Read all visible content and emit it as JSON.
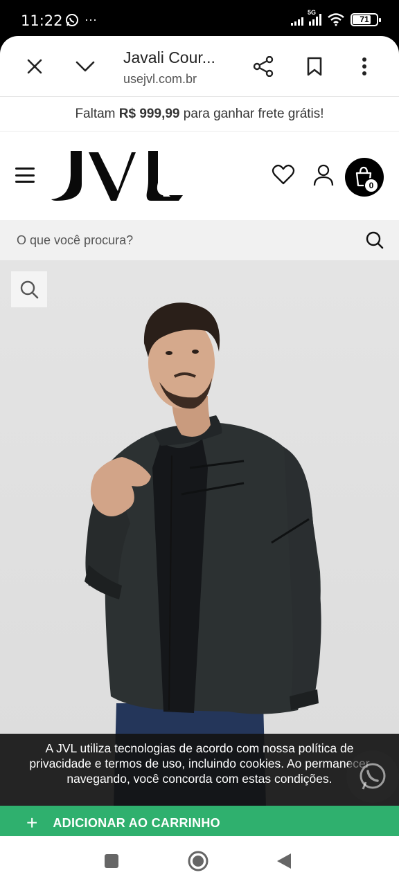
{
  "status_bar": {
    "time": "11:22",
    "more": "···",
    "network": "5G",
    "battery": "71",
    "battery_level": 0.71
  },
  "browser": {
    "title": "Javali Cour...",
    "url": "usejvl.com.br"
  },
  "shipping_banner": {
    "prefix": "Faltam ",
    "amount": "R$ 999,99",
    "suffix": " para ganhar frete grátis!"
  },
  "header": {
    "logo": "JVL",
    "cart_count": "0"
  },
  "search": {
    "placeholder": "O que você procura?"
  },
  "cookie": {
    "text": "A JVL utiliza tecnologias de acordo com nossa política de privacidade e termos de uso, incluindo cookies. Ao permanecer navegando, você concorda com estas condições."
  },
  "add_to_cart": {
    "plus": "+",
    "label": "ADICIONAR AO CARRINHO"
  },
  "colors": {
    "accent_green": "#2fb06e",
    "black": "#000000"
  },
  "icons": [
    "whatsapp-icon",
    "close-icon",
    "chevron-down-icon",
    "share-icon",
    "bookmark-icon",
    "more-vert-icon",
    "menu-icon",
    "heart-icon",
    "user-icon",
    "shopping-bag-icon",
    "search-icon",
    "zoom-icon",
    "recents-icon",
    "home-icon",
    "back-icon"
  ]
}
